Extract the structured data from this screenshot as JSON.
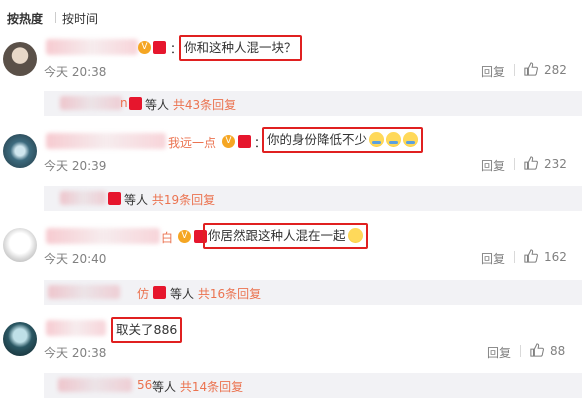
{
  "sort": {
    "hot": "按热度",
    "time": "按时间"
  },
  "comments": [
    {
      "name_tail": "",
      "text": "你和这种人混一块？",
      "emojis": [],
      "time": "今天 20:38",
      "reply": "回复",
      "likes": "282",
      "sub": {
        "name_tail": "n",
        "by": "等人",
        "count": "共43条回复"
      }
    },
    {
      "name_tail": "我远一点",
      "text": "你的身份降低不少",
      "emojis": [
        "sweat-emoji",
        "sweat-emoji",
        "sweat-emoji"
      ],
      "time": "今天 20:39",
      "reply": "回复",
      "likes": "232",
      "sub": {
        "name_tail": "",
        "by": "等人",
        "count": "共19条回复"
      }
    },
    {
      "name_tail": "白",
      "text": "你居然跟这种人混在一起",
      "emojis": [
        "thinking-emoji"
      ],
      "time": "今天 20:40",
      "reply": "回复",
      "likes": "162",
      "sub": {
        "name_tail": "仿",
        "by": "等人",
        "count": "共16条回复"
      }
    },
    {
      "name_tail": "",
      "text": "取关了886",
      "emojis": [],
      "time": "今天 20:38",
      "reply": "回复",
      "likes": "88",
      "sub": {
        "name_tail": "56",
        "by": "等人",
        "count": "共14条回复"
      }
    }
  ],
  "colors": {
    "accent": "#eb7350",
    "highlight_border": "#e02020",
    "muted": "#808080"
  },
  "icons": {
    "like": "thumbs-up-icon",
    "vip": "vip-badge-icon",
    "red_packet": "red-packet-icon"
  }
}
